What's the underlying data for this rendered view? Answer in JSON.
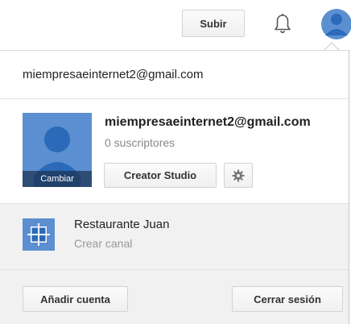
{
  "header": {
    "upload_label": "Subir",
    "icons": [
      "bell-icon",
      "avatar"
    ]
  },
  "account_menu": {
    "email": "miempresaeinternet2@gmail.com",
    "account": {
      "name": "miempresaeinternet2@gmail.com",
      "subscribers": "0 suscriptores",
      "change_label": "Cambiar",
      "creator_studio_label": "Creator Studio",
      "settings_icon": "gear-icon"
    },
    "channel": {
      "name": "Restaurante Juan",
      "action": "Crear canal"
    },
    "footer": {
      "add_account_label": "Añadir cuenta",
      "sign_out_label": "Cerrar sesión"
    }
  },
  "colors": {
    "avatar_blue": "#5b8fd1",
    "avatar_person": "#2a6ab8",
    "panel_gray": "#f1f1f1"
  }
}
